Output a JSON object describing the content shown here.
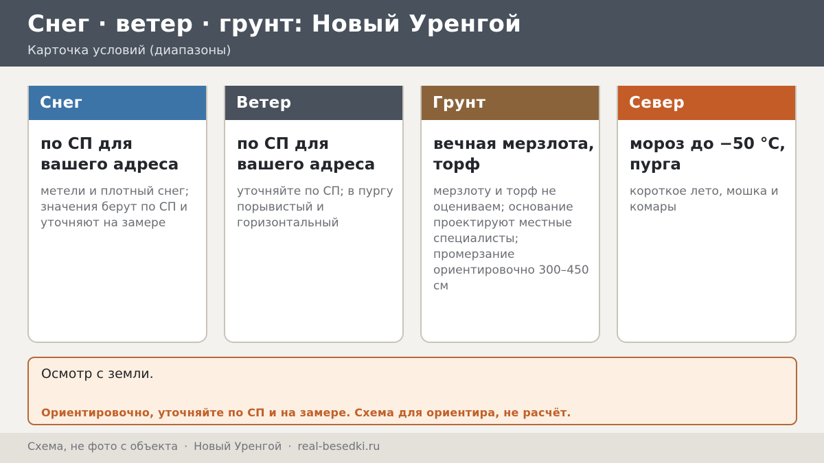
{
  "header": {
    "title": "Снег · ветер · грунт: Новый Уренгой",
    "subtitle": "Карточка условий (диапазоны)"
  },
  "cards": [
    {
      "title": "Снег",
      "main": "по СП для вашего адреса",
      "note": "метели и плотный снег; значения берут по СП и уточняют на замере",
      "color": "#3d74a8"
    },
    {
      "title": "Ветер",
      "main": "по СП для вашего адреса",
      "note": "уточняйте по СП; в пургу порывистый и горизонтальный",
      "color": "#48515c"
    },
    {
      "title": "Грунт",
      "main": "вечная мерзлота, торф",
      "note": "мерзлоту и торф не оцениваем; основание проектируют местные специалисты; промерзание ориентировочно 300–450 см",
      "color": "#8a633b"
    },
    {
      "title": "Север",
      "main": "мороз до −50 °C, пурга",
      "note": "короткое лето, мошка и комары",
      "color": "#c45c28"
    }
  ],
  "note_box": {
    "text": "Осмотр с земли.",
    "warning": "Ориентировочно, уточняйте по СП и на замере. Схема для ориентира, не расчёт."
  },
  "footer": {
    "items": [
      "Схема, не фото с объекта",
      "Новый Уренгой",
      "real-besedki.ru"
    ],
    "separator": "·"
  }
}
